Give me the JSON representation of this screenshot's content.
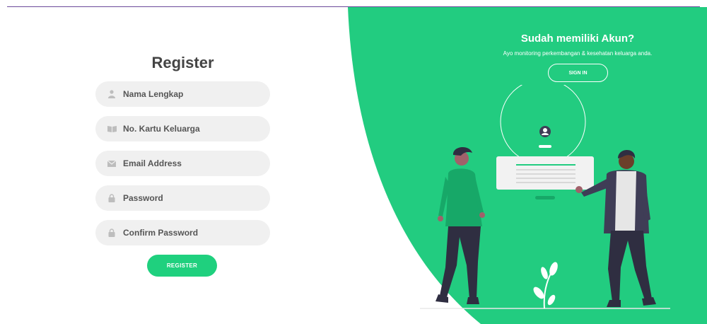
{
  "register": {
    "title": "Register",
    "fields": [
      {
        "icon": "user-icon",
        "placeholder": "Nama Lengkap"
      },
      {
        "icon": "book-icon",
        "placeholder": "No. Kartu Keluarga"
      },
      {
        "icon": "envelope-icon",
        "placeholder": "Email Address"
      },
      {
        "icon": "lock-icon",
        "placeholder": "Password"
      },
      {
        "icon": "lock-icon",
        "placeholder": "Confirm Password"
      }
    ],
    "button_label": "REGISTER"
  },
  "signin_panel": {
    "title": "Sudah memiliki Akun?",
    "subtitle": "Ayo monitoring perkembangan & kesehatan keluarga anda.",
    "button_label": "SIGN IN"
  },
  "colors": {
    "accent": "#1fd07e",
    "panel_bg": "#22cc80",
    "field_bg": "#f0f0f0",
    "text_dark": "#444444"
  }
}
